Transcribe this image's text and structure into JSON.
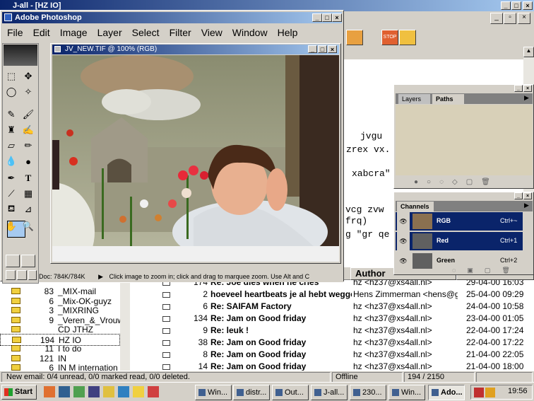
{
  "outer_window": {
    "title": "J-all - [HZ IO]"
  },
  "ps": {
    "title": "Adobe Photoshop",
    "menu": [
      "File",
      "Edit",
      "Image",
      "Layer",
      "Select",
      "Filter",
      "View",
      "Window",
      "Help"
    ],
    "doc_title": "JV_NEW.TIF @ 100% (RGB)",
    "status_doc": "Doc: 784K/784K",
    "status_hint": "Click image to zoom in; click and drag to marquee zoom.  Use Alt and C"
  },
  "layers_panel": {
    "tabs": [
      "Layers",
      "Paths"
    ]
  },
  "channels_panel": {
    "tab": "Channels",
    "channels": [
      {
        "name": "RGB",
        "shortcut": "Ctrl+~"
      },
      {
        "name": "Red",
        "shortcut": "Ctrl+1"
      },
      {
        "name": "Green",
        "shortcut": "Ctrl+2"
      }
    ]
  },
  "background_text": [
    "jvgu",
    "zrex vx.",
    "xabcra\"",
    "vcg zvw",
    "frq)",
    "g \"gr qe"
  ],
  "folders": [
    {
      "count": "83",
      "name": "_MIX-mail"
    },
    {
      "count": "6",
      "name": "_Mix-OK-guyz"
    },
    {
      "count": "3",
      "name": "_MIXRING"
    },
    {
      "count": "9",
      "name": "_Veren_&_Vrouw"
    },
    {
      "count": "",
      "name": "CD JTHZ"
    },
    {
      "count": "194",
      "name": "HZ IO"
    },
    {
      "count": "11",
      "name": "I to do"
    },
    {
      "count": "121",
      "name": "IN"
    },
    {
      "count": "6",
      "name": "IN M internation"
    }
  ],
  "mail_header": {
    "author": "Author"
  },
  "mails": [
    {
      "count": "174",
      "subject": "Re: Joe dies when he cries",
      "author": "hz <hz37@xs4all.nl>",
      "date": "29-04-00 16:03"
    },
    {
      "count": "2",
      "subject": "hoeveel heartbeats je al hebt wegge",
      "author": "Hens Zimmerman <hens@gm",
      "date": "25-04-00 09:29"
    },
    {
      "count": "6",
      "subject": "Re: SAIFAM Factory",
      "author": "hz <hz37@xs4all.nl>",
      "date": "24-04-00 10:58"
    },
    {
      "count": "134",
      "subject": "Re: Jam on Good friday",
      "author": "hz <hz37@xs4all.nl>",
      "date": "23-04-00 01:05"
    },
    {
      "count": "9",
      "subject": "Re: leuk !",
      "author": "hz <hz37@xs4all.nl>",
      "date": "22-04-00 17:24"
    },
    {
      "count": "38",
      "subject": "Re: Jam on Good friday",
      "author": "hz <hz37@xs4all.nl>",
      "date": "22-04-00 17:22"
    },
    {
      "count": "8",
      "subject": "Re: Jam on Good friday",
      "author": "hz <hz37@xs4all.nl>",
      "date": "21-04-00 22:05"
    },
    {
      "count": "14",
      "subject": "Re: Jam on Good friday",
      "author": "hz <hz37@xs4all.nl>",
      "date": "21-04-00 18:00"
    }
  ],
  "statusbar": {
    "left": "New email: 0/4 unread, 0/0 marked read, 0/0 deleted.",
    "mid": "Offline",
    "count": "194 / 2150"
  },
  "taskbar": {
    "start": "Start",
    "tasks": [
      "Win...",
      "distr...",
      "Out...",
      "J-all...",
      "230...",
      "Win...",
      "Ado..."
    ],
    "clock": "19:56"
  },
  "colors": {
    "titlebar": "#0a246a",
    "desktop": "#d4d0c8",
    "foreground_swatch": "#a6caf0",
    "background_swatch": "#2050d8"
  }
}
